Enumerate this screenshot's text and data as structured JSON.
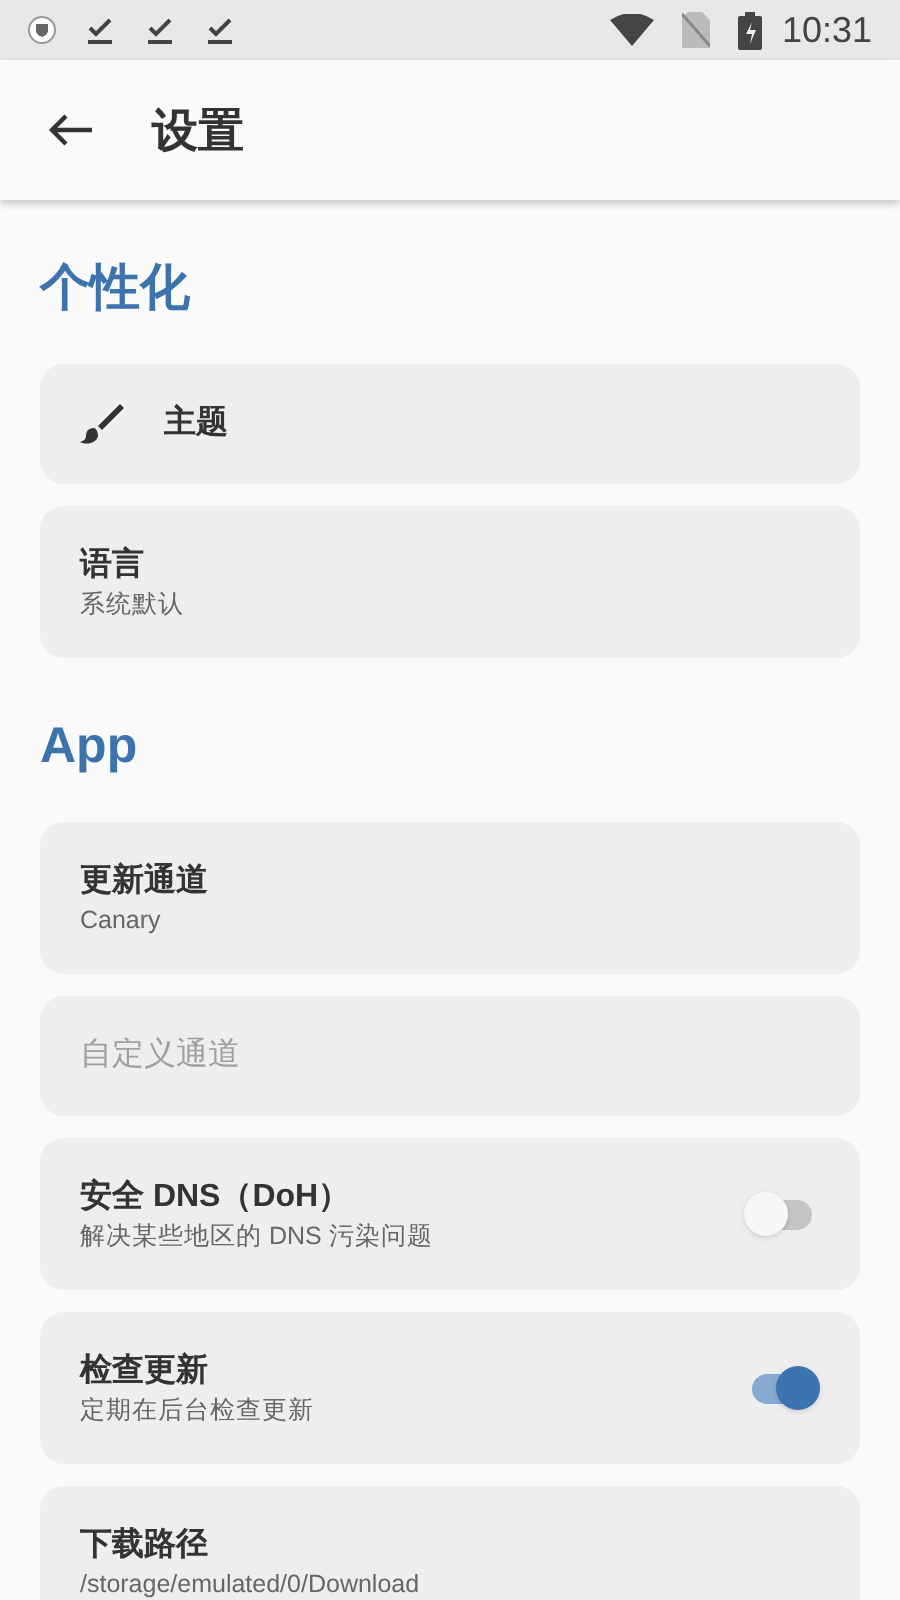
{
  "status_bar": {
    "time": "10:31"
  },
  "app_bar": {
    "title": "设置"
  },
  "sections": [
    {
      "title": "个性化",
      "items": [
        {
          "kind": "icon",
          "title": "主题",
          "disabled": false
        },
        {
          "kind": "text",
          "title": "语言",
          "subtitle": "系统默认",
          "disabled": false
        }
      ]
    },
    {
      "title": "App",
      "items": [
        {
          "kind": "text",
          "title": "更新通道",
          "subtitle": "Canary",
          "disabled": false
        },
        {
          "kind": "text",
          "title": "自定义通道",
          "disabled": true
        },
        {
          "kind": "switch",
          "title": "安全 DNS（DoH）",
          "subtitle": "解决某些地区的 DNS 污染问题",
          "on": false,
          "disabled": false
        },
        {
          "kind": "switch",
          "title": "检查更新",
          "subtitle": "定期在后台检查更新",
          "on": true,
          "disabled": false
        },
        {
          "kind": "text",
          "title": "下载路径",
          "subtitle": "/storage/emulated/0/Download",
          "disabled": false
        }
      ]
    }
  ]
}
